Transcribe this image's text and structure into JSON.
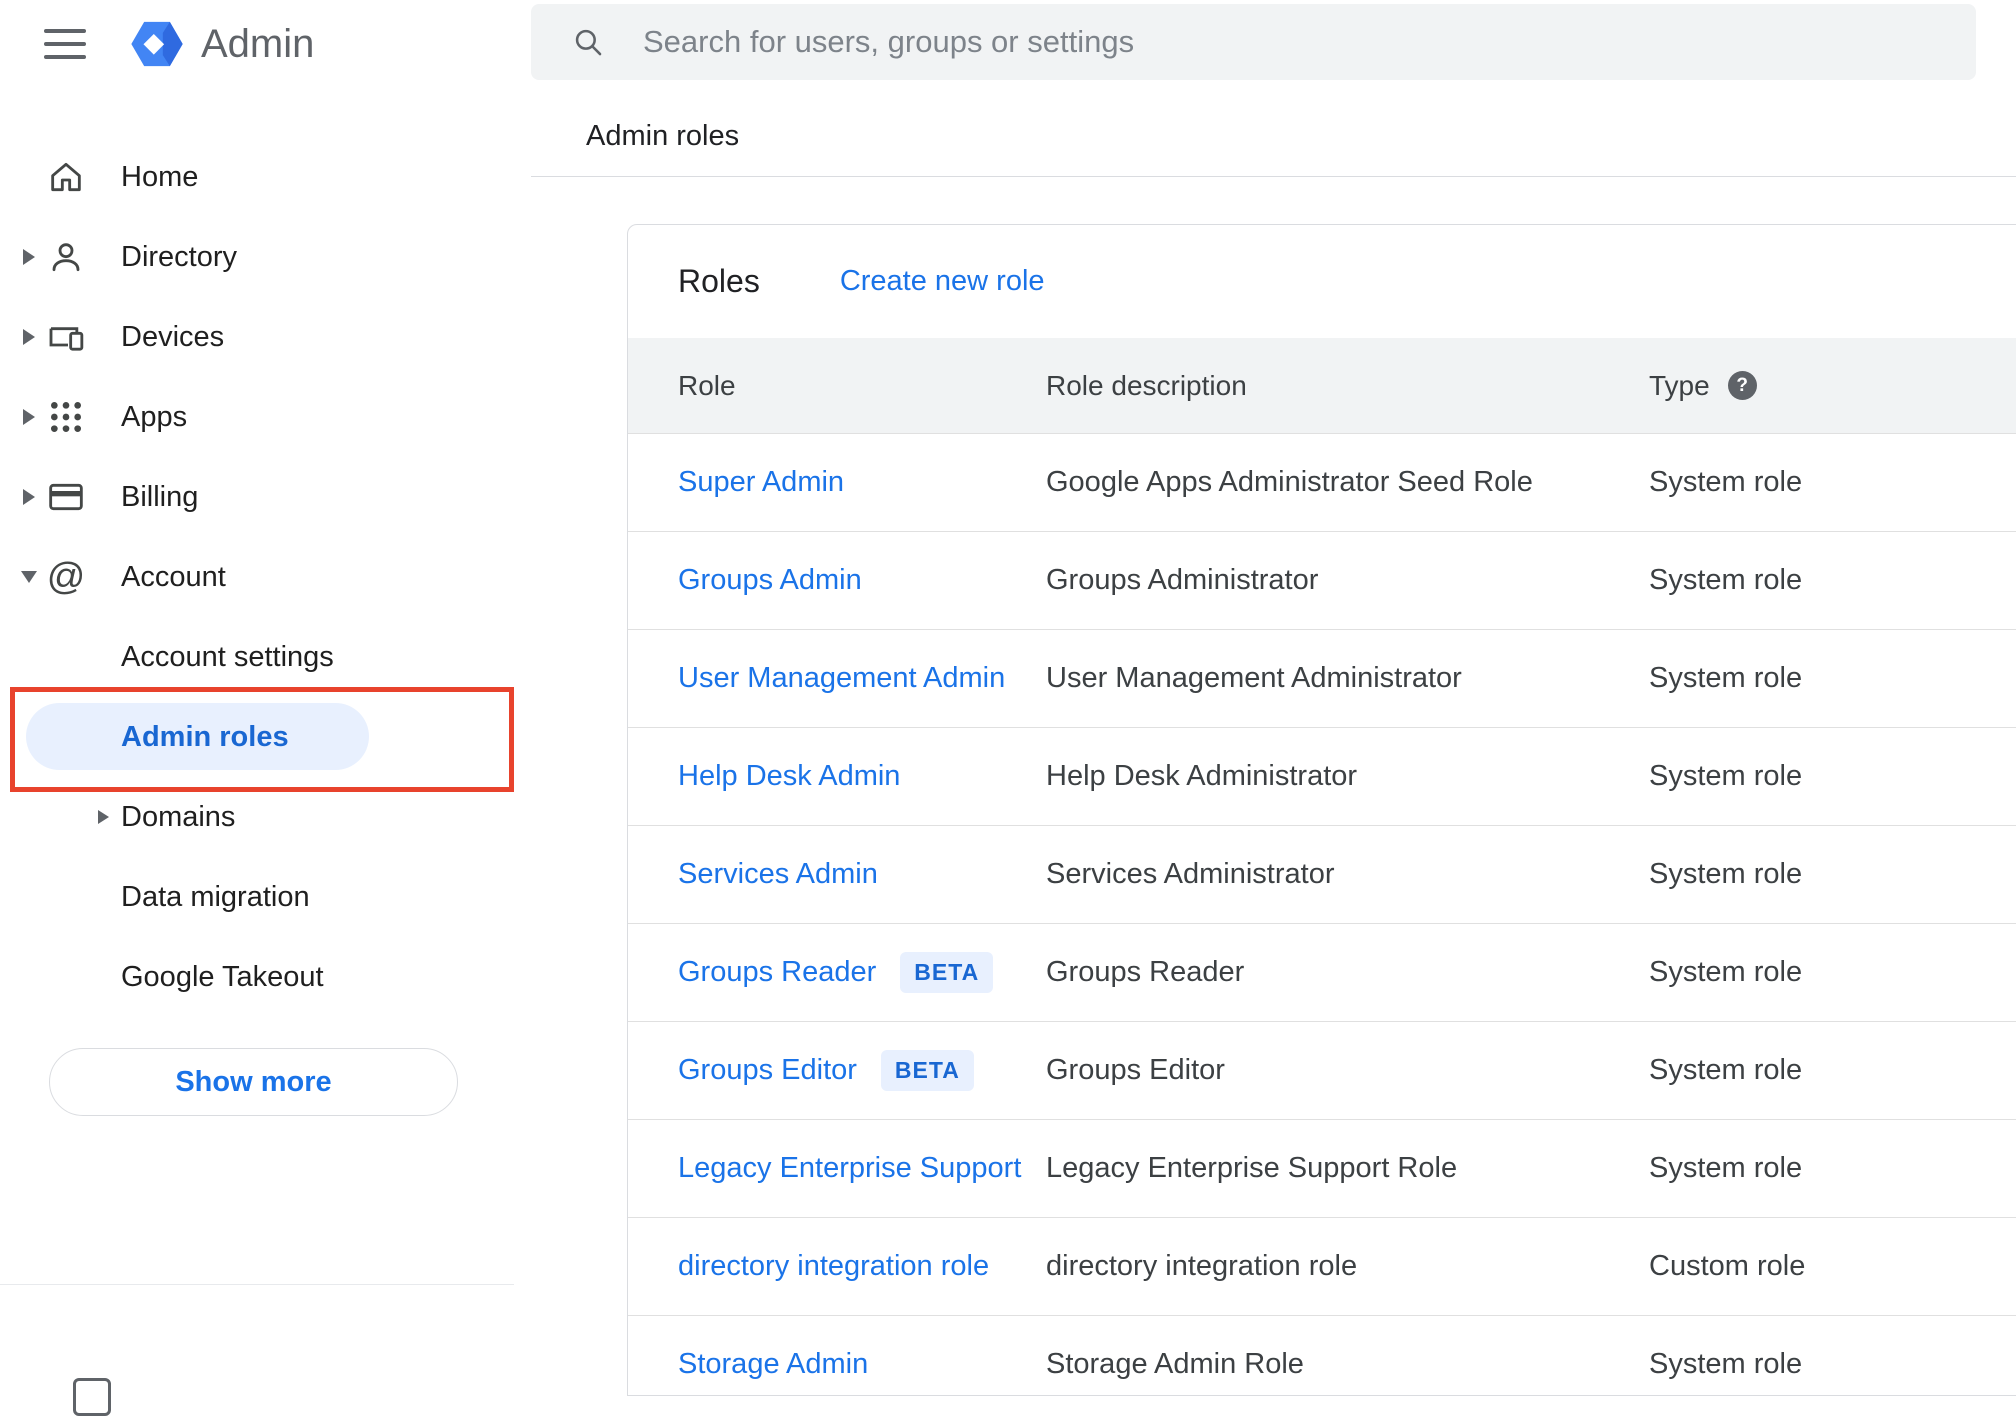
{
  "topbar": {
    "app_name": "Admin",
    "search_placeholder": "Search for users, groups or settings"
  },
  "breadcrumb": {
    "label": "Admin roles"
  },
  "sidebar": {
    "items": [
      {
        "label": "Home"
      },
      {
        "label": "Directory"
      },
      {
        "label": "Devices"
      },
      {
        "label": "Apps"
      },
      {
        "label": "Billing"
      },
      {
        "label": "Account"
      }
    ],
    "sub_items": [
      {
        "label": "Account settings",
        "selected": false
      },
      {
        "label": "Admin roles",
        "selected": true
      },
      {
        "label": "Domains",
        "selected": false
      },
      {
        "label": "Data migration",
        "selected": false
      },
      {
        "label": "Google Takeout",
        "selected": false
      }
    ],
    "show_more_label": "Show more"
  },
  "roles": {
    "title": "Roles",
    "create_new_role": "Create new role",
    "beta_label": "BETA",
    "columns": {
      "role": "Role",
      "description": "Role description",
      "type": "Type"
    },
    "rows": [
      {
        "role": "Super Admin",
        "beta": false,
        "description": "Google Apps Administrator Seed Role",
        "type": "System role"
      },
      {
        "role": "Groups Admin",
        "beta": false,
        "description": "Groups Administrator",
        "type": "System role"
      },
      {
        "role": "User Management Admin",
        "beta": false,
        "description": "User Management Administrator",
        "type": "System role"
      },
      {
        "role": "Help Desk Admin",
        "beta": false,
        "description": "Help Desk Administrator",
        "type": "System role"
      },
      {
        "role": "Services Admin",
        "beta": false,
        "description": "Services Administrator",
        "type": "System role"
      },
      {
        "role": "Groups Reader",
        "beta": true,
        "description": "Groups Reader",
        "type": "System role"
      },
      {
        "role": "Groups Editor",
        "beta": true,
        "description": "Groups Editor",
        "type": "System role"
      },
      {
        "role": "Legacy Enterprise Support",
        "beta": false,
        "description": "Legacy Enterprise Support Role",
        "type": "System role"
      },
      {
        "role": "directory integration role",
        "beta": false,
        "description": "directory integration role",
        "type": "Custom role"
      },
      {
        "role": "Storage Admin",
        "beta": false,
        "description": "Storage Admin Role",
        "type": "System role"
      }
    ]
  },
  "icons": {
    "at_glyph": "@",
    "help_glyph": "?"
  },
  "colors": {
    "link_blue": "#1a73e8",
    "selected_item_text": "#1967d2",
    "selected_item_bg": "#e8f0fe",
    "beta_badge_bg": "#e8f0fe",
    "table_header_bg": "#f1f3f4",
    "search_bar_bg": "#f1f3f4",
    "annotation_red": "#e8432d",
    "icon_gray": "#5f6368",
    "row_border": "#e0e0e0"
  }
}
